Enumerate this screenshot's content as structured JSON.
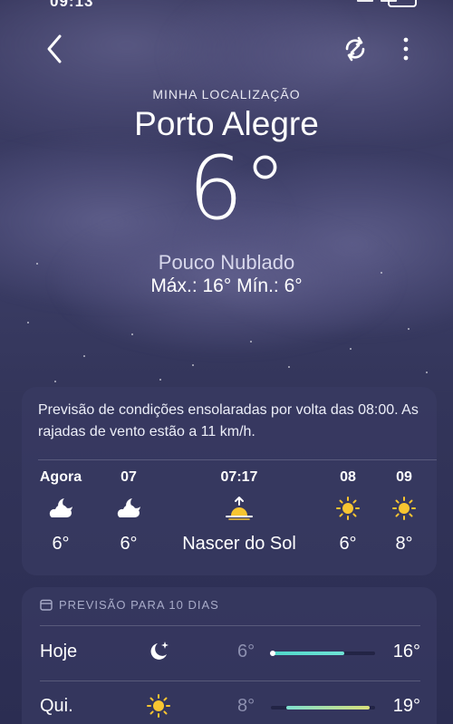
{
  "status_bar": {
    "time": "09:13"
  },
  "nav": {
    "back_icon": "chevron-left-icon",
    "sync_icon": "sync-icon",
    "more_icon": "more-vertical-icon"
  },
  "header": {
    "location_label": "MINHA LOCALIZAÇÃO",
    "city": "Porto Alegre",
    "temperature": "6°",
    "condition": "Pouco Nublado",
    "max_min": "Máx.: 16°  Mín.: 6°"
  },
  "hourly": {
    "summary": "Previsão de condições ensolaradas por volta das 08:00. As rajadas de vento estão a 11 km/h.",
    "items": [
      {
        "label": "Agora",
        "icon": "moon-cloud-icon",
        "value": "6°"
      },
      {
        "label": "07",
        "icon": "moon-cloud-icon",
        "value": "6°"
      },
      {
        "label": "07:17",
        "icon": "sunrise-icon",
        "value": "Nascer do Sol"
      },
      {
        "label": "08",
        "icon": "sun-icon",
        "value": "6°"
      },
      {
        "label": "09",
        "icon": "sun-icon",
        "value": "8°"
      }
    ]
  },
  "daily": {
    "header": "PREVISÃO PARA 10 DIAS",
    "header_icon": "calendar-icon",
    "days": [
      {
        "name": "Hoje",
        "icon": "moon-stars-icon",
        "low": "6°",
        "high": "16°",
        "range_start": 0.0,
        "range_end": 0.7,
        "current_pos": 0.0,
        "gradient": "#4fd6c9,#6fe3d5"
      },
      {
        "name": "Qui.",
        "icon": "sun-icon",
        "low": "8°",
        "high": "19°",
        "range_start": 0.15,
        "range_end": 0.95,
        "gradient": "#7fe0d0,#d9e07a"
      }
    ]
  },
  "colors": {
    "sun": "#f7c531",
    "accent_teal": "#4fd6c9"
  }
}
